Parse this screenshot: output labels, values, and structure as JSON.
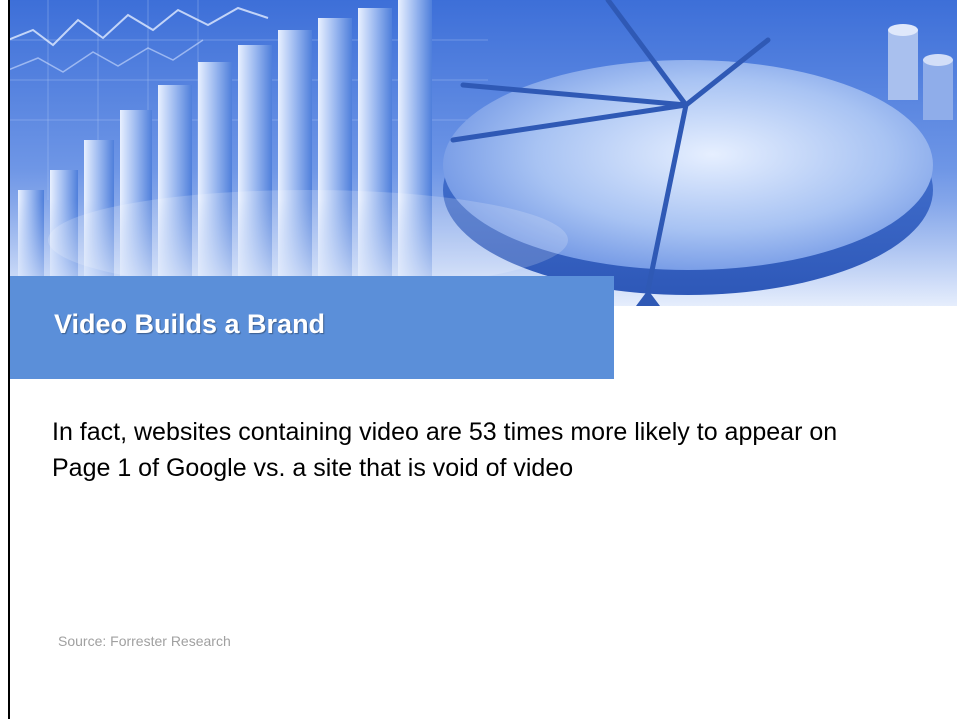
{
  "slide": {
    "title": "Video Builds a Brand",
    "body": "In fact, websites containing video are 53 times more likely to appear on Page 1 of Google vs. a site that is void of video",
    "source": "Source:  Forrester Research"
  },
  "theme": {
    "title_bar_color": "#5b8fd9",
    "title_text_color": "#ffffff",
    "body_text_color": "#000000",
    "source_text_color": "#a0a0a0",
    "header_image": "blue-business-charts-pie-and-bars-photo"
  }
}
